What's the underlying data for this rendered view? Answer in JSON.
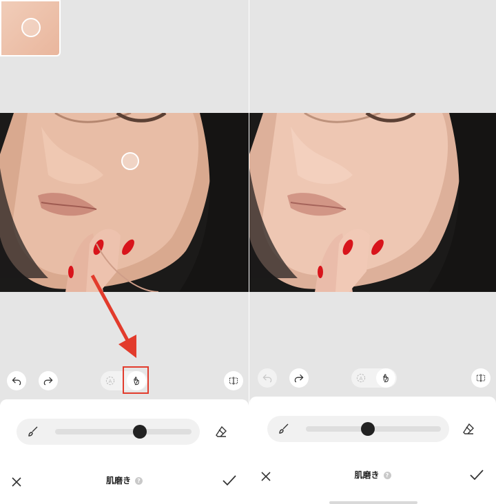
{
  "left": {
    "sheet": {
      "title": "肌磨き",
      "help": "?"
    },
    "slider": {
      "value": 0.62
    }
  },
  "right": {
    "sheet": {
      "title": "肌磨き",
      "help": "?"
    },
    "slider": {
      "value": 0.46
    }
  },
  "icons": {
    "undo": "undo-icon",
    "redo": "redo-icon",
    "auto": "auto-mode-icon",
    "manual": "hand-touch-icon",
    "compare": "compare-icon",
    "brush": "brush-icon",
    "eraser": "eraser-icon",
    "close": "close-icon",
    "confirm": "check-icon"
  },
  "colors": {
    "highlight": "#e23b2c",
    "nail": "#d8141b"
  }
}
